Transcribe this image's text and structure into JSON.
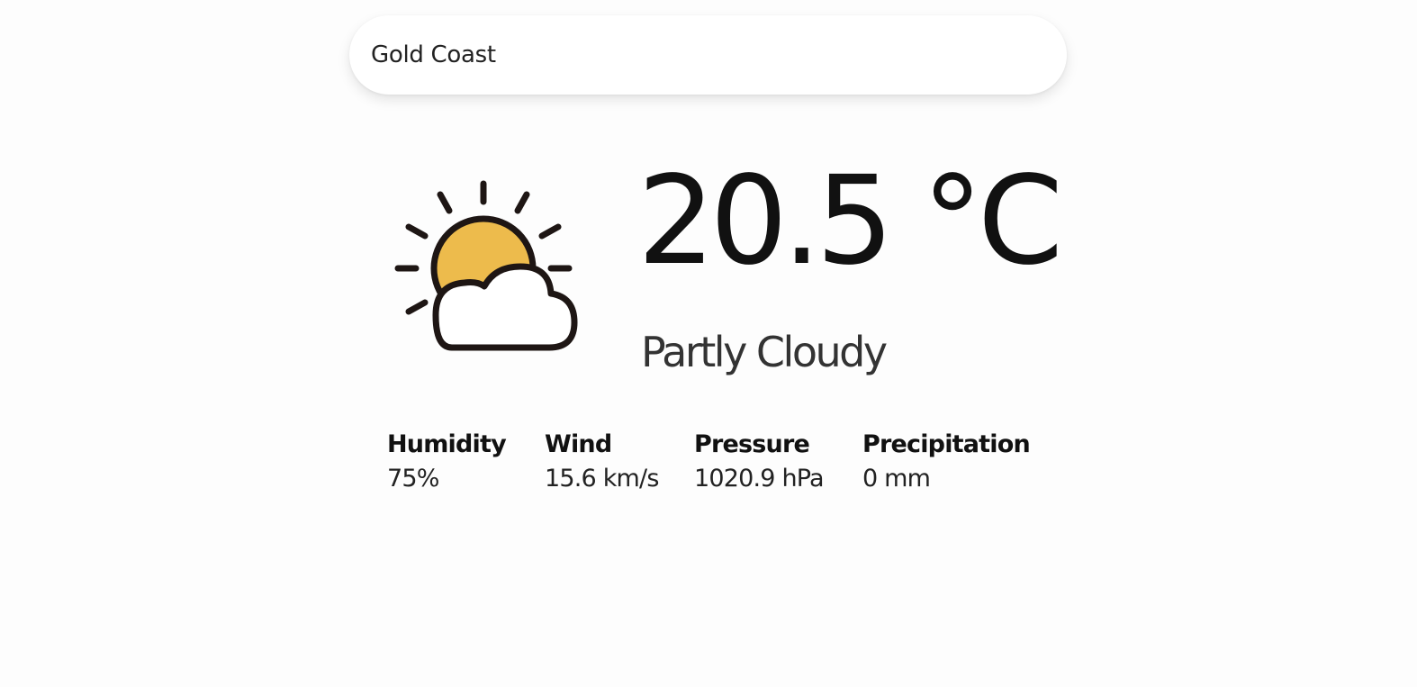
{
  "search": {
    "value": "Gold Coast"
  },
  "current": {
    "icon": "partly-cloudy-icon",
    "temperature": "20.5 °C",
    "condition": "Partly Cloudy"
  },
  "stats": [
    {
      "label": "Humidity",
      "value": "75%"
    },
    {
      "label": "Wind",
      "value": "15.6 km/s"
    },
    {
      "label": "Pressure",
      "value": "1020.9 hPa"
    },
    {
      "label": "Precipitation",
      "value": "0 mm"
    }
  ],
  "colors": {
    "sun": "#EDBB4C",
    "outline": "#1E1614",
    "cloud_fill": "#FFFFFF",
    "background": "#FDFDFD"
  }
}
